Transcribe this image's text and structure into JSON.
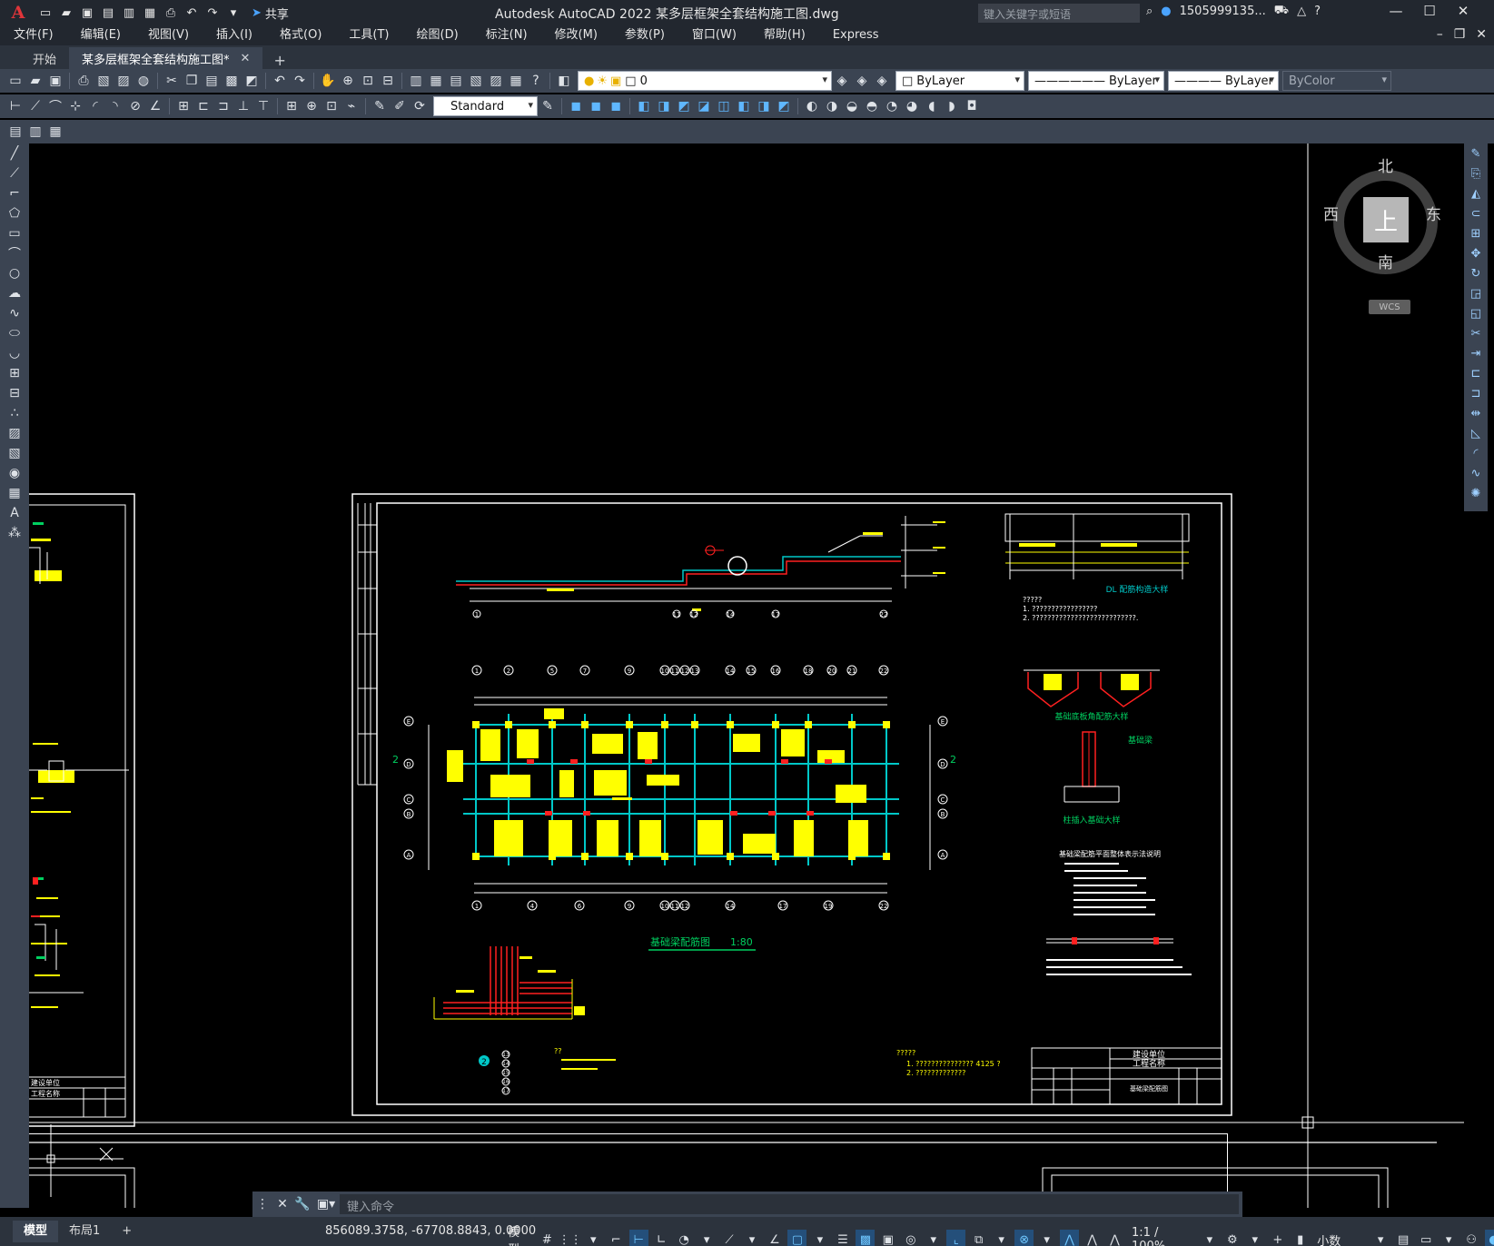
{
  "title_bar": {
    "logo": "A",
    "app_title": "Autodesk AutoCAD 2022    某多层框架全套结构施工图.dwg",
    "share_label": "共享",
    "search_placeholder": "键入关键字或短语",
    "user": "1505999135...",
    "quick_access_icons": [
      "new-icon",
      "open-icon",
      "save-icon",
      "saveas-icon",
      "publish-icon",
      "share-icon",
      "print-icon",
      "undo-icon",
      "redo-icon",
      "customize-icon"
    ],
    "right_icons": [
      "search-icon",
      "user-icon",
      "cart-icon",
      "autodesk-icon",
      "help-icon"
    ]
  },
  "menu": [
    "文件(F)",
    "编辑(E)",
    "视图(V)",
    "插入(I)",
    "格式(O)",
    "工具(T)",
    "绘图(D)",
    "标注(N)",
    "修改(M)",
    "参数(P)",
    "窗口(W)",
    "帮助(H)",
    "Express"
  ],
  "tabs": [
    {
      "label": "开始",
      "active": false
    },
    {
      "label": "某多层框架全套结构施工图*",
      "active": true
    }
  ],
  "toolbar1": {
    "layer": "0",
    "color": "ByLayer",
    "linetype": "ByLayer",
    "lineweight": "ByLayer",
    "plotstyle": "ByColor"
  },
  "toolbar2": {
    "dimstyle": "Standard"
  },
  "viewcube": {
    "north": "北",
    "south": "南",
    "east": "东",
    "west": "西",
    "face": "上",
    "wcs": "WCS"
  },
  "command_line": {
    "placeholder": "键入命令"
  },
  "status_bar": {
    "layout_tabs": [
      "模型",
      "布局1"
    ],
    "coordinates": "856089.3758, -67708.8843, 0.0000",
    "model_label": "模型",
    "scale": "1:1 / 100%",
    "units": "小数"
  },
  "drawing": {
    "main_title": "基础梁配筋图",
    "main_scale": "1:80",
    "detail_labels": [
      "DL 配筋构造大样",
      "基础底板角配筋大样",
      "柱插入基础大样",
      "基础梁"
    ],
    "notes_title": "基础梁配筋平面整体表示法说明",
    "notes_q1": "?????",
    "notes_q1_line1": "1. ?????????????????",
    "notes_q1_line2": "2. ???????????????????????????.",
    "title_block_company": "建设单位",
    "title_block_project": "工程名称",
    "title_block_drawing": "基础梁配筋图",
    "note_bottom_q": "?????",
    "note_bottom_1": "1. ??????????????? 4125    ?",
    "note_bottom_2": "2. ?????????????",
    "axes_top": [
      "1",
      "2",
      "5",
      "7",
      "9",
      "10",
      "11",
      "12",
      "13",
      "14",
      "15",
      "16",
      "18",
      "20",
      "21",
      "22"
    ],
    "axes_bottom": [
      "1",
      "4",
      "6",
      "9",
      "10",
      "11",
      "12",
      "14",
      "17",
      "19",
      "22"
    ],
    "axes_side": [
      "E",
      "D",
      "C",
      "B",
      "A"
    ],
    "section_labels": [
      "2",
      "2"
    ],
    "section_axes": [
      "1",
      "11",
      "12",
      "14",
      "17",
      "22"
    ],
    "left_sheet_texts": [
      "建设单位",
      "工程名称"
    ],
    "bottom_left_numbers": [
      "13",
      "14",
      "15",
      "16",
      "17"
    ],
    "bottom_left_mark": "2",
    "bottom_left_note": "??"
  },
  "colors": {
    "title_bg": "#22272f",
    "toolbar_bg": "#3b4452",
    "canvas_bg": "#000000",
    "cad_white": "#ffffff",
    "cad_cyan": "#00c8c8",
    "cad_yellow": "#ffff00",
    "cad_red": "#ff2020",
    "cad_green": "#00d060"
  }
}
